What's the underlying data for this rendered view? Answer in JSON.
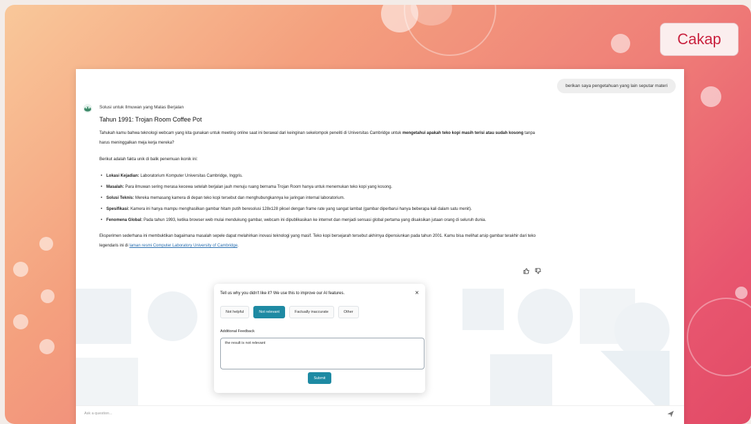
{
  "brand": {
    "label": "Cakap"
  },
  "chat": {
    "user_message": "berikan saya pengetahuan yang lain seputar materi",
    "bot_name": "Solusi untuk Ilmuwan yang Malas Berjalan",
    "answer": {
      "title": "Tahun 1991: Trojan Room Coffee Pot",
      "intro_before": "Tahukah kamu bahwa teknologi webcam yang kita gunakan untuk meeting online saat ini berawal dari keinginan sekelompok peneliti di Universitas Cambridge untuk ",
      "intro_bold": "mengetahui apakah teko kopi masih terisi atau sudah kosong",
      "intro_after": " tanpa harus meninggalkan meja kerja mereka?",
      "facts_intro": "Berikut adalah fakta unik di balik penemuan ikonik ini:",
      "facts": [
        {
          "label": "Lokasi Kejadian:",
          "text": " Laboratorium Komputer Universitas Cambridge, Inggris."
        },
        {
          "label": "Masalah:",
          "text": " Para ilmuwan sering merasa kecewa setelah berjalan jauh menuju ruang bernama Trojan Room hanya untuk menemukan teko kopi yang kosong."
        },
        {
          "label": "Solusi Teknis:",
          "text": " Mereka memasang kamera di depan teko kopi tersebut dan menghubungkannya ke jaringan internal laboratorium."
        },
        {
          "label": "Spesifikasi:",
          "text": " Kamera ini hanya mampu menghasilkan gambar hitam putih beresolusi 128x128 piksel dengan frame rate yang sangat lambat (gambar diperbarui hanya beberapa kali dalam satu menit)."
        },
        {
          "label": "Fenomena Global:",
          "text": " Pada tahun 1993, ketika browser web mulai mendukung gambar, webcam ini dipublikasikan ke internet dan menjadi sensasi global pertama yang disaksikan jutaan orang di seluruh dunia."
        }
      ],
      "closing": "Eksperimen sederhana ini membuktikan bagaimana masalah sepele dapat melahirkan inovasi teknologi yang masif. Teko kopi bersejarah tersebut akhirnya dipensiunkan pada tahun 2001. Kamu bisa melihat arsip gambar terakhir dari teko legendaris ini di ",
      "link": "laman resmi Computer Laboratory University of Cambridge",
      "closing_end": "."
    },
    "input_placeholder": "Ask a question..."
  },
  "feedback_modal": {
    "title": "Tell us why you didn't like it? We use this to improve our AI features.",
    "close": "×",
    "options": [
      "Not helpful",
      "Not relevant",
      "Factually inaccurate",
      "Other"
    ],
    "selected": "Not relevant",
    "additional_label": "Additional Feedback",
    "additional_value": "the result is not relevant",
    "submit_label": "Submit"
  },
  "icons": {
    "thumbs_up": "thumbs-up-icon",
    "thumbs_down": "thumbs-down-icon",
    "send": "send-icon",
    "close": "close-icon",
    "bot": "bot-avatar-icon"
  },
  "colors": {
    "accent": "#1e8aa3",
    "brand_text": "#c9223f",
    "link": "#2a6fb0"
  }
}
